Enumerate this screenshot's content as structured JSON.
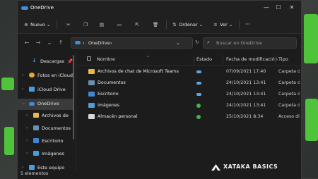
{
  "window": {
    "title": "OneDrive"
  },
  "window_controls": {
    "minimize": "—",
    "maximize": "☐",
    "close": "✕"
  },
  "toolbar": {
    "new_label": "Nuevo",
    "sort_label": "Ordenar",
    "view_label": "Ver",
    "more_label": "···"
  },
  "address": {
    "path": [
      "OneDrive"
    ],
    "search_placeholder": "Buscar en OneDrive"
  },
  "sidebar": {
    "items": [
      {
        "label": "Descargas"
      },
      {
        "label": "Fotos en iCloud"
      },
      {
        "label": "iCloud Drive"
      },
      {
        "label": "OneDrive"
      },
      {
        "label": "Archivos de chat"
      },
      {
        "label": "Documentos"
      },
      {
        "label": "Escritorio"
      },
      {
        "label": "Imágenes"
      },
      {
        "label": "Este equipo"
      }
    ]
  },
  "table": {
    "columns": [
      "Nombre",
      "Estado",
      "Fecha de modificación",
      "Tipo"
    ],
    "rows": [
      {
        "name": "Archivos de chat de Microsoft Teams",
        "status": "cloud",
        "date": "07/09/2021 17:40",
        "type": "Carpeta de archivos"
      },
      {
        "name": "Documentos",
        "status": "cloud",
        "date": "24/10/2021 13:41",
        "type": "Carpeta de archivos"
      },
      {
        "name": "Escritorio",
        "status": "cloud",
        "date": "24/10/2021 13:41",
        "type": "Carpeta de archivos"
      },
      {
        "name": "Imágenes",
        "status": "synced",
        "date": "24/10/2021 13:41",
        "type": "Carpeta de archivos"
      },
      {
        "name": "Almacén personal",
        "status": "synced",
        "date": "25/10/2021 8:34",
        "type": "Acceso directo"
      }
    ]
  },
  "statusbar": {
    "count": "5 elementos"
  },
  "watermark": {
    "text": "XATAKA BASICS"
  },
  "colors": {
    "accent": "#3a8fe0",
    "folder": "#e8b94a",
    "synced": "#3fb74f",
    "cloud": "#5aa7ea",
    "desktop_green": "#5fd24a"
  }
}
